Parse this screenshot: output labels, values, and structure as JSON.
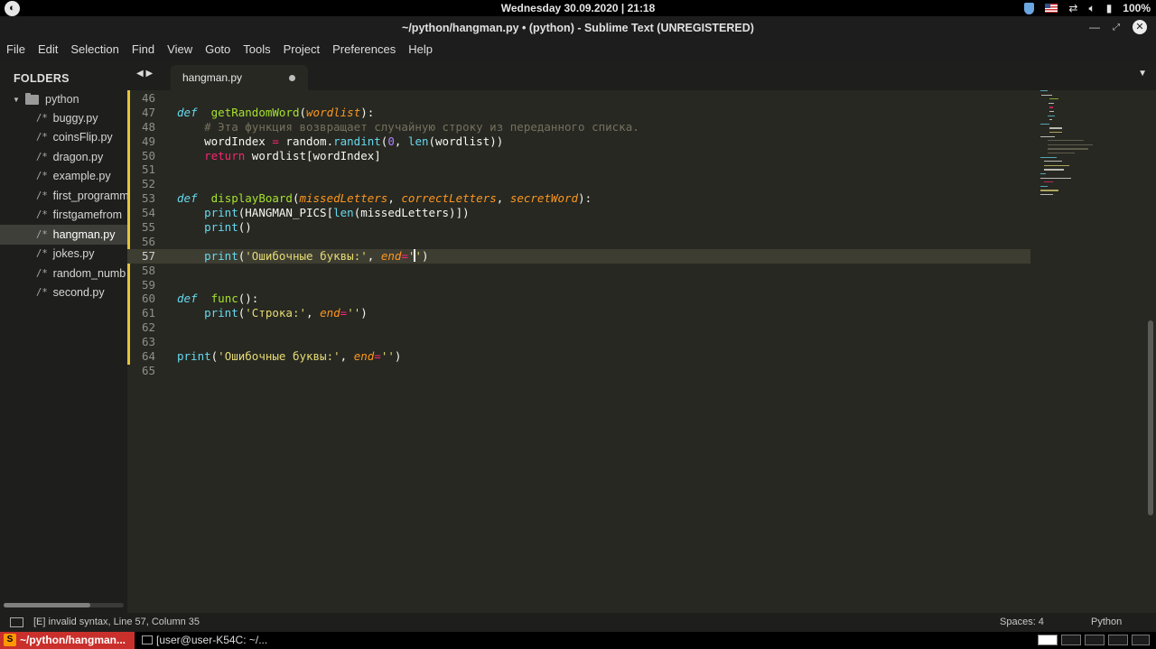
{
  "system_bar": {
    "logo": "◐",
    "clock": "Wednesday 30.09.2020 | 21:18",
    "battery": "100%",
    "tray_icons": [
      "shield-icon",
      "us-flag-icon",
      "network-icon",
      "volume-icon",
      "battery-icon"
    ]
  },
  "window": {
    "title": "~/python/hangman.py • (python) - Sublime Text (UNREGISTERED)",
    "minimize": "—",
    "restore": "✕",
    "close": "✕"
  },
  "menu": [
    "File",
    "Edit",
    "Selection",
    "Find",
    "View",
    "Goto",
    "Tools",
    "Project",
    "Preferences",
    "Help"
  ],
  "sidebar": {
    "header": "FOLDERS",
    "folder": "python",
    "files": [
      {
        "name": "buggy.py",
        "active": false
      },
      {
        "name": "coinsFlip.py",
        "active": false
      },
      {
        "name": "dragon.py",
        "active": false
      },
      {
        "name": "example.py",
        "active": false
      },
      {
        "name": "first_programm",
        "active": false
      },
      {
        "name": "firstgamefrom",
        "active": false
      },
      {
        "name": "hangman.py",
        "active": true
      },
      {
        "name": "jokes.py",
        "active": false
      },
      {
        "name": "random_numb",
        "active": false
      },
      {
        "name": "second.py",
        "active": false
      }
    ],
    "file_icon": "/*"
  },
  "tab": {
    "label": "hangman.py",
    "nav_arrows": "◀ ▶",
    "dropdown": "▼"
  },
  "editor": {
    "current_line": 57,
    "lines": [
      {
        "n": "46",
        "tokens": []
      },
      {
        "n": "47",
        "tokens": [
          [
            "kw",
            "def"
          ],
          [
            "",
            "  "
          ],
          [
            "fn",
            "getRandomWord"
          ],
          [
            "",
            "("
          ],
          [
            "pm",
            "wordlist"
          ],
          [
            "",
            "):"
          ]
        ]
      },
      {
        "n": "48",
        "tokens": [
          [
            "",
            "    "
          ],
          [
            "cm",
            "# Эта функция возвращает случайную строку из переданного списка."
          ]
        ]
      },
      {
        "n": "49",
        "tokens": [
          [
            "",
            "    wordIndex "
          ],
          [
            "rk",
            "="
          ],
          [
            "",
            " random."
          ],
          [
            "bi",
            "randint"
          ],
          [
            "",
            "("
          ],
          [
            "nm",
            "0"
          ],
          [
            "",
            ", "
          ],
          [
            "bi",
            "len"
          ],
          [
            "",
            "(wordlist))"
          ]
        ]
      },
      {
        "n": "50",
        "tokens": [
          [
            "",
            "    "
          ],
          [
            "rk",
            "return"
          ],
          [
            "",
            " wordlist[wordIndex]"
          ]
        ]
      },
      {
        "n": "51",
        "tokens": []
      },
      {
        "n": "52",
        "tokens": []
      },
      {
        "n": "53",
        "tokens": [
          [
            "kw",
            "def"
          ],
          [
            "",
            "  "
          ],
          [
            "fn",
            "displayBoard"
          ],
          [
            "",
            "("
          ],
          [
            "pm",
            "missedLetters"
          ],
          [
            "",
            ", "
          ],
          [
            "pm",
            "correctLetters"
          ],
          [
            "",
            ", "
          ],
          [
            "pm",
            "secretWord"
          ],
          [
            "",
            "):"
          ]
        ]
      },
      {
        "n": "54",
        "tokens": [
          [
            "",
            "    "
          ],
          [
            "bi",
            "print"
          ],
          [
            "",
            "(HANGMAN_PICS["
          ],
          [
            "bi",
            "len"
          ],
          [
            "",
            "(missedLetters)])"
          ]
        ]
      },
      {
        "n": "55",
        "tokens": [
          [
            "",
            "    "
          ],
          [
            "bi",
            "print"
          ],
          [
            "",
            "()"
          ]
        ]
      },
      {
        "n": "56",
        "tokens": []
      },
      {
        "n": "57",
        "tokens": [
          [
            "",
            "    "
          ],
          [
            "bi",
            "print"
          ],
          [
            "",
            "("
          ],
          [
            "st",
            "'Ошибочные буквы:'"
          ],
          [
            "",
            ", "
          ],
          [
            "pm",
            "end"
          ],
          [
            "rk",
            "="
          ],
          [
            "st",
            "'"
          ],
          [
            "caret",
            ""
          ],
          [
            "st",
            "'"
          ],
          [
            "",
            ")"
          ]
        ]
      },
      {
        "n": "58",
        "tokens": []
      },
      {
        "n": "59",
        "tokens": []
      },
      {
        "n": "60",
        "tokens": [
          [
            "kw",
            "def"
          ],
          [
            "",
            "  "
          ],
          [
            "fn",
            "func"
          ],
          [
            "",
            "():"
          ]
        ]
      },
      {
        "n": "61",
        "tokens": [
          [
            "",
            "    "
          ],
          [
            "bi",
            "print"
          ],
          [
            "",
            "("
          ],
          [
            "st",
            "'Строка:'"
          ],
          [
            "",
            ", "
          ],
          [
            "pm",
            "end"
          ],
          [
            "rk",
            "="
          ],
          [
            "st",
            "''"
          ],
          [
            "",
            ")"
          ]
        ]
      },
      {
        "n": "62",
        "tokens": []
      },
      {
        "n": "63",
        "tokens": []
      },
      {
        "n": "64",
        "tokens": [
          [
            "bi",
            "print"
          ],
          [
            "",
            "("
          ],
          [
            "st",
            "'Ошибочные буквы:'"
          ],
          [
            "",
            ", "
          ],
          [
            "pm",
            "end"
          ],
          [
            "rk",
            "="
          ],
          [
            "st",
            "''"
          ],
          [
            "",
            ")"
          ]
        ]
      },
      {
        "n": "65",
        "tokens": []
      }
    ]
  },
  "status": {
    "message": "[E] invalid syntax, Line 57, Column 35",
    "spaces": "Spaces: 4",
    "syntax": "Python"
  },
  "taskbar": {
    "task1": "~/python/hangman...",
    "task1_icon": "S",
    "task2": "[user@user-K54C: ~/..."
  },
  "colors": {
    "editor_bg": "#272822",
    "sidebar_bg": "#1e1f1c",
    "keyword": "#66d9ef",
    "function": "#a6e22e",
    "param": "#fd971f",
    "string": "#e6db74",
    "comment": "#75715e",
    "operator": "#f92672",
    "number": "#ae81ff",
    "modified_marker": "#e6c43a"
  }
}
